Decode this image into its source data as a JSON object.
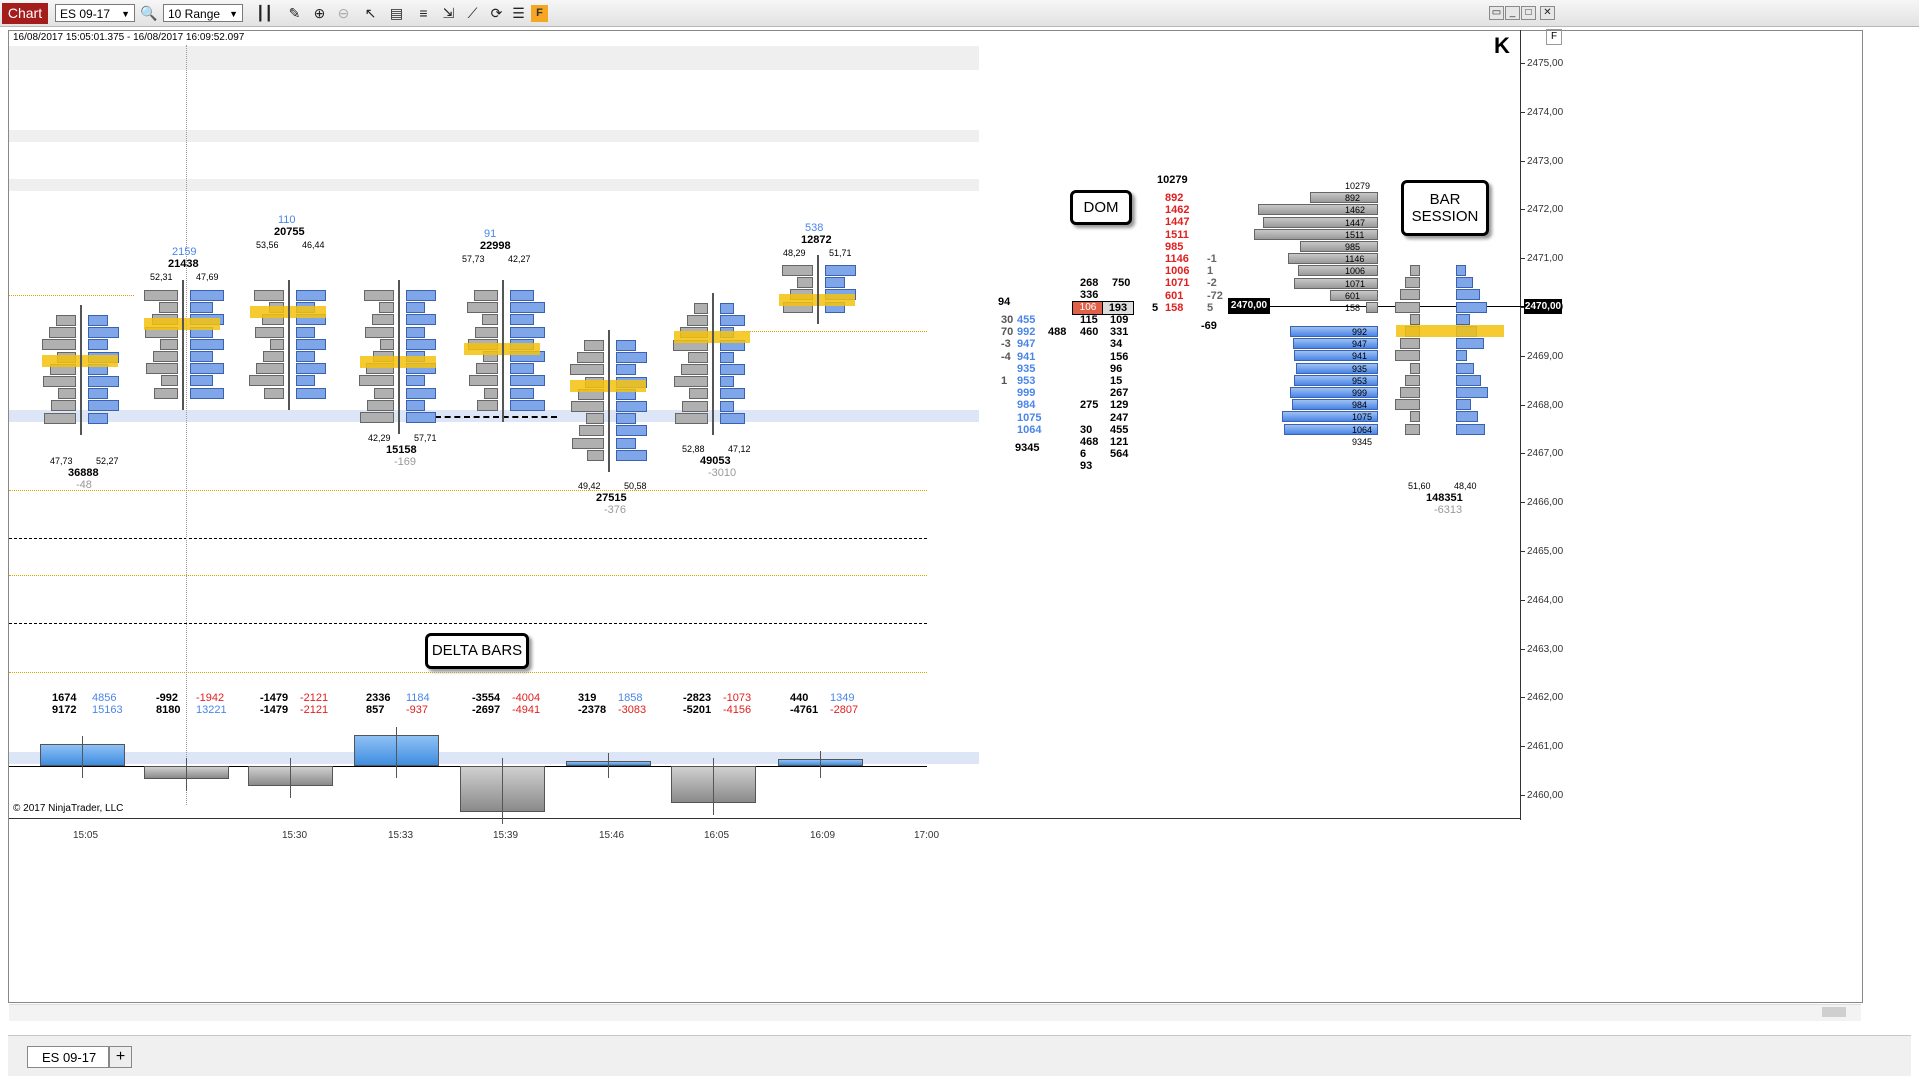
{
  "toolbar": {
    "chart_tab": "Chart",
    "instrument": "ES 09-17",
    "bar_type": "10 Range",
    "badge": "F"
  },
  "chart": {
    "date_range": "16/08/2017 15:05:01.375 - 16/08/2017 16:09:52.097",
    "copyright": "© 2017 NinjaTrader, LLC",
    "top_right_marker": "K",
    "f_marker": "F",
    "price_axis": [
      "2475,00",
      "2474,00",
      "2473,00",
      "2472,00",
      "2471,00",
      "2470,00",
      "2469,00",
      "2468,00",
      "2467,00",
      "2466,00",
      "2465,00",
      "2464,00",
      "2463,00",
      "2462,00",
      "2461,00",
      "2460,00"
    ],
    "price_marker": "2470,00",
    "time_axis": [
      "15:05",
      "15:30",
      "15:33",
      "15:39",
      "15:46",
      "16:05",
      "16:09",
      "17:00"
    ]
  },
  "callouts": {
    "dom": "DOM",
    "bar_session_1": "BAR",
    "bar_session_2": "SESSION",
    "delta_bars": "DELTA BARS"
  },
  "footprints": [
    {
      "top_blue": "2159",
      "volume": "21438",
      "pct_l": "52,31",
      "pct_r": "47,69"
    },
    {
      "top_blue": "110",
      "volume": "20755",
      "pct_l": "53,56",
      "pct_r": "46,44"
    },
    {
      "top_blue": "91",
      "volume": "22998",
      "pct_l": "57,73",
      "pct_r": "42,27"
    },
    {
      "top_blue": "538",
      "volume": "12872",
      "pct_l": "48,29",
      "pct_r": "51,71"
    }
  ],
  "bar_totals": [
    {
      "pct_l": "47,73",
      "pct_r": "52,27",
      "vol": "36888",
      "delta": "-48"
    },
    {
      "pct_l": "42,29",
      "pct_r": "57,71",
      "vol": "15158",
      "delta": "-169"
    },
    {
      "pct_l": "49,42",
      "pct_r": "50,58",
      "vol": "27515",
      "delta": "-376"
    },
    {
      "pct_l": "52,88",
      "pct_r": "47,12",
      "vol": "49053",
      "delta": "-3010"
    },
    {
      "pct_l": "51,60",
      "pct_r": "48,40",
      "vol": "148351",
      "delta": "-6313"
    }
  ],
  "delta_rows": [
    {
      "a": "1674",
      "b": "9172",
      "c": "4856",
      "d": "15163"
    },
    {
      "a": "-992",
      "b": "8180",
      "c": "-1942",
      "d": "13221"
    },
    {
      "a": "-1479",
      "b": "-1479",
      "c": "-2121",
      "d": "-2121"
    },
    {
      "a": "2336",
      "b": "857",
      "c": "1184",
      "d": "-937"
    },
    {
      "a": "-3554",
      "b": "-2697",
      "c": "-4004",
      "d": "-4941"
    },
    {
      "a": "319",
      "b": "-2378",
      "c": "1858",
      "d": "-3083"
    },
    {
      "a": "-2823",
      "b": "-5201",
      "c": "-1073",
      "d": "-4156"
    },
    {
      "a": "440",
      "b": "-4761",
      "c": "1349",
      "d": "-2807"
    }
  ],
  "dom": {
    "top_total": "10279",
    "asks": [
      "892",
      "1462",
      "1447",
      "1511",
      "985",
      "1146",
      "1006",
      "1071",
      "601",
      "158"
    ],
    "ask_changes": [
      "-1",
      "1",
      "-2",
      "-72",
      "5"
    ],
    "ask_size_col": [
      "268",
      "336"
    ],
    "ask_size_col2": [
      "750"
    ],
    "current_bid": "106",
    "current_ask": "193",
    "bid_left": [
      "30",
      "70",
      "-3",
      "-4",
      "",
      "1"
    ],
    "bid_blue": [
      "455",
      "992",
      "947",
      "941",
      "935",
      "953",
      "999",
      "984",
      "1075",
      "1064"
    ],
    "bid_mid": [
      "115",
      "460",
      "",
      "",
      "",
      "",
      "",
      "275",
      "",
      "30",
      "468",
      "6",
      "93"
    ],
    "bid_right": [
      "109",
      "331",
      "34",
      "156",
      "96",
      "15",
      "267",
      "129",
      "247",
      "455",
      "121",
      "564"
    ],
    "total_bid": "9345",
    "side_94": "94",
    "side_488": "488",
    "side_5": "5",
    "side_minus69": "-69"
  },
  "session_profile": {
    "ask_values": [
      "10279",
      "892",
      "1462",
      "1447",
      "1511",
      "985",
      "1146",
      "1006",
      "1071",
      "601",
      "158"
    ],
    "bid_values": [
      "992",
      "947",
      "941",
      "935",
      "953",
      "999",
      "984",
      "1075",
      "1064",
      "9345"
    ]
  }
}
